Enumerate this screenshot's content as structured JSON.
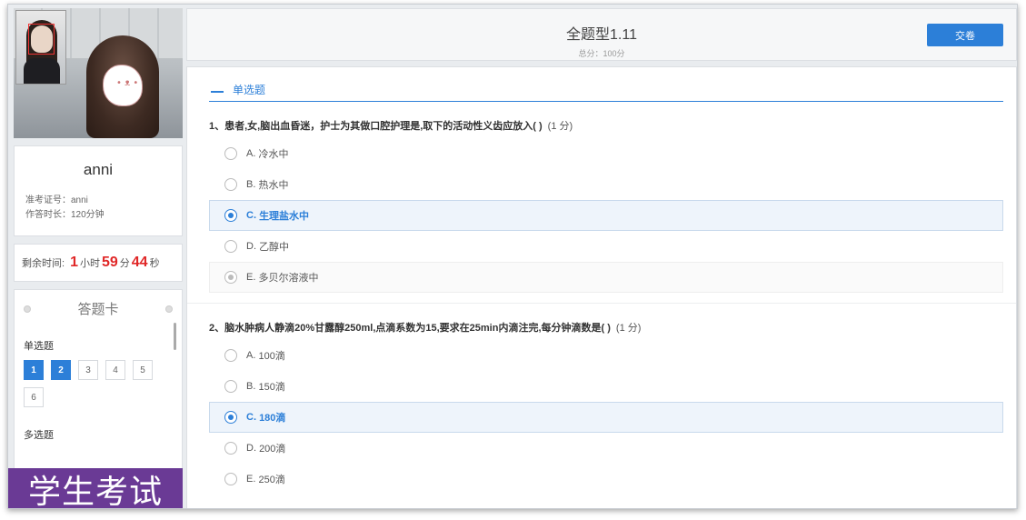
{
  "student": {
    "name": "anni",
    "exam_id_label": "准考证号：",
    "exam_id": "anni",
    "duration_label": "作答时长：",
    "duration": "120分钟"
  },
  "timer": {
    "label": "剩余时间:",
    "hours": "1",
    "hours_unit": "小时",
    "minutes": "59",
    "minutes_unit": "分",
    "seconds": "44",
    "seconds_unit": "秒"
  },
  "answer_sheet": {
    "title": "答题卡",
    "sections": [
      {
        "label": "单选题",
        "cells": [
          "1",
          "2",
          "3",
          "4",
          "5",
          "6"
        ],
        "done": [
          0,
          1
        ]
      },
      {
        "label": "多选题"
      }
    ]
  },
  "banner": "学生考试",
  "header": {
    "title": "全题型1.11",
    "score": "总分：100分",
    "submit_label": "交卷"
  },
  "section_title": "单选题",
  "questions": [
    {
      "stem": "1、患者,女,脑出血昏迷，护士为其做口腔护理是,取下的活动性义齿应放入( )",
      "points": "(1 分)",
      "options": [
        {
          "letter": "A.",
          "text": "冷水中"
        },
        {
          "letter": "B.",
          "text": "热水中"
        },
        {
          "letter": "C.",
          "text": "生理盐水中"
        },
        {
          "letter": "D.",
          "text": "乙醇中"
        },
        {
          "letter": "E.",
          "text": "多贝尔溶液中"
        }
      ]
    },
    {
      "stem": "2、脑水肿病人静滴20%甘露醇250ml,点滴系数为15,要求在25min内滴注完,每分钟滴数是( )",
      "points": "(1 分)",
      "options": [
        {
          "letter": "A.",
          "text": "100滴"
        },
        {
          "letter": "B.",
          "text": "150滴"
        },
        {
          "letter": "C.",
          "text": "180滴"
        },
        {
          "letter": "D.",
          "text": "200滴"
        },
        {
          "letter": "E.",
          "text": "250滴"
        }
      ]
    }
  ],
  "colors": {
    "accent": "#2c7fd8",
    "timer": "#e02727",
    "banner": "#6a3a95"
  }
}
